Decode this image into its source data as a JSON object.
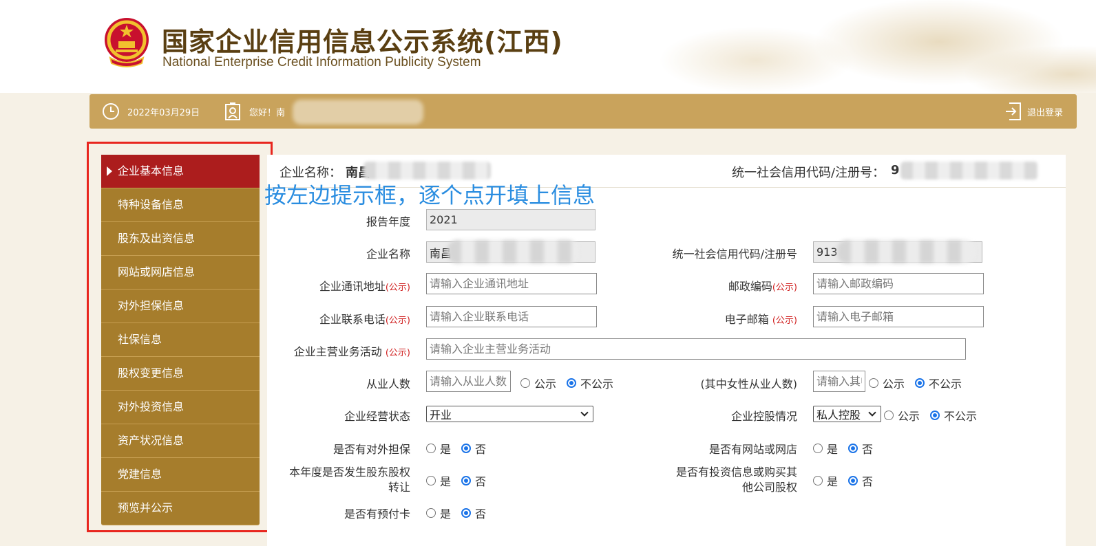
{
  "header": {
    "title": "国家企业信用信息公示系统(江西)",
    "subtitle": "National Enterprise Credit Information Publicity System"
  },
  "topbar": {
    "date": "2022年03月29日",
    "greeting": "您好！南",
    "logout": "退出登录"
  },
  "sidebar": {
    "items": [
      {
        "label": "企业基本信息"
      },
      {
        "label": "特种设备信息"
      },
      {
        "label": "股东及出资信息"
      },
      {
        "label": "网站或网店信息"
      },
      {
        "label": "对外担保信息"
      },
      {
        "label": "社保信息"
      },
      {
        "label": "股权变更信息"
      },
      {
        "label": "对外投资信息"
      },
      {
        "label": "资产状况信息"
      },
      {
        "label": "党建信息"
      },
      {
        "label": "预览并公示"
      }
    ],
    "active_index": 0
  },
  "main": {
    "enterprise_label": "企业名称：",
    "enterprise_value": "南昌",
    "code_label": "统一社会信用代码/注册号：",
    "code_value": "9",
    "hint": "按左边提示框，逐个点开填上信息"
  },
  "form": {
    "public_tag": "(公示)",
    "report_year_label": "报告年度",
    "report_year_value": "2021",
    "ent_name_label": "企业名称",
    "ent_name_value": "南昌",
    "credit_code_label": "统一社会信用代码/注册号",
    "credit_code_value": "913",
    "address_label": "企业通讯地址",
    "address_placeholder": "请输入企业通讯地址",
    "postcode_label": "邮政编码",
    "postcode_placeholder": "请输入邮政编码",
    "phone_label": "企业联系电话",
    "phone_placeholder": "请输入企业联系电话",
    "email_label": "电子邮箱",
    "email_placeholder": "请输入电子邮箱",
    "business_label": "企业主营业务活动",
    "business_placeholder": "请输入企业主营业务活动",
    "employees_label": "从业人数",
    "employees_placeholder": "请输入从业人数",
    "female_label": "(其中女性从业人数)",
    "female_placeholder": "请输入其中",
    "status_label": "企业经营状态",
    "status_value": "开业",
    "holding_label": "企业控股情况",
    "holding_value": "私人控股",
    "guarantee_label": "是否有对外担保",
    "website_label": "是否有网站或网店",
    "equity_label_line1": "本年度是否发生股东股权",
    "equity_label_line2": "转让",
    "invest_label_line1": "是否有投资信息或购买其",
    "invest_label_line2": "他公司股权",
    "prepaid_label": "是否有预付卡",
    "opt_public": "公示",
    "opt_not_public": "不公示",
    "opt_yes": "是",
    "opt_no": "否"
  },
  "colors": {
    "header_gold": "#c9a35c",
    "sidebar_item": "#a67d2c",
    "sidebar_active": "#ac1d1d",
    "frame_red": "#e8261e",
    "hint_blue": "#2a8de0",
    "public_red": "#d02020"
  }
}
